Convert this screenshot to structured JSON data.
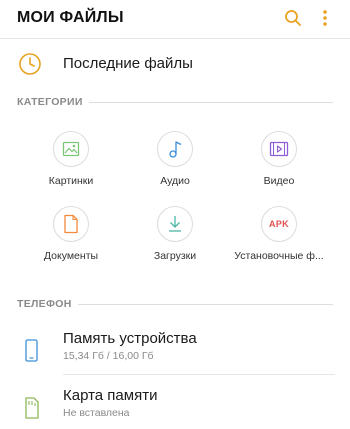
{
  "header": {
    "title": "МОИ ФАЙЛЫ",
    "search_icon": "search-icon",
    "more_icon": "more-vertical-icon",
    "accent": "#e8a321"
  },
  "recent": {
    "label": "Последние файлы",
    "icon": "clock-icon"
  },
  "categories_section": {
    "title": "КАТЕГОРИИ",
    "items": [
      {
        "label": "Картинки",
        "icon": "image-icon",
        "color": "#7cc576"
      },
      {
        "label": "Аудио",
        "icon": "music-note-icon",
        "color": "#3c8fd9"
      },
      {
        "label": "Видео",
        "icon": "video-icon",
        "color": "#8f5fd6"
      },
      {
        "label": "Документы",
        "icon": "document-icon",
        "color": "#f08a3c"
      },
      {
        "label": "Загрузки",
        "icon": "download-icon",
        "color": "#4cb6a3"
      },
      {
        "label": "Установочные ф...",
        "icon": "apk-icon",
        "badge": "APK",
        "color": "#e05252"
      }
    ]
  },
  "phone_section": {
    "title": "ТЕЛЕФОН",
    "items": [
      {
        "title": "Память устройства",
        "subtitle": "15,34 Гб / 16,00 Гб",
        "icon": "phone-icon",
        "color": "#3c8fd9"
      },
      {
        "title": "Карта памяти",
        "subtitle": "Не вставлена",
        "icon": "sd-card-icon",
        "color": "#8bb85a"
      }
    ]
  }
}
